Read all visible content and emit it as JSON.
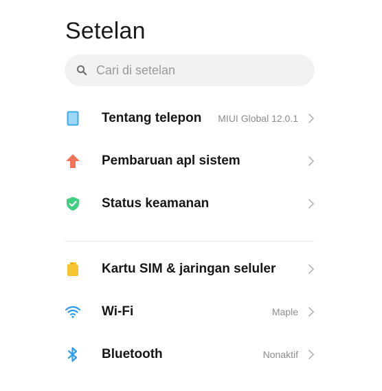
{
  "header": {
    "title": "Setelan"
  },
  "search": {
    "placeholder": "Cari di setelan",
    "icon": "search-icon"
  },
  "colors": {
    "phone": "#6fc3f0",
    "update": "#f4715a",
    "security": "#3fcf7e",
    "sim": "#f6c532",
    "wifi": "#2a9df4",
    "bluetooth": "#2a9df4"
  },
  "groups": [
    {
      "items": [
        {
          "label": "Tentang telepon",
          "value": "MIUI Global 12.0.1",
          "icon": "phone-icon"
        },
        {
          "label": "Pembaruan apl sistem",
          "value": "",
          "icon": "arrow-up-icon"
        },
        {
          "label": "Status keamanan",
          "value": "",
          "icon": "shield-check-icon"
        }
      ]
    },
    {
      "items": [
        {
          "label": "Kartu SIM & jaringan seluler",
          "value": "",
          "icon": "sim-card-icon"
        },
        {
          "label": "Wi-Fi",
          "value": "Maple",
          "icon": "wifi-icon"
        },
        {
          "label": "Bluetooth",
          "value": "Nonaktif",
          "icon": "bluetooth-icon"
        }
      ]
    }
  ]
}
